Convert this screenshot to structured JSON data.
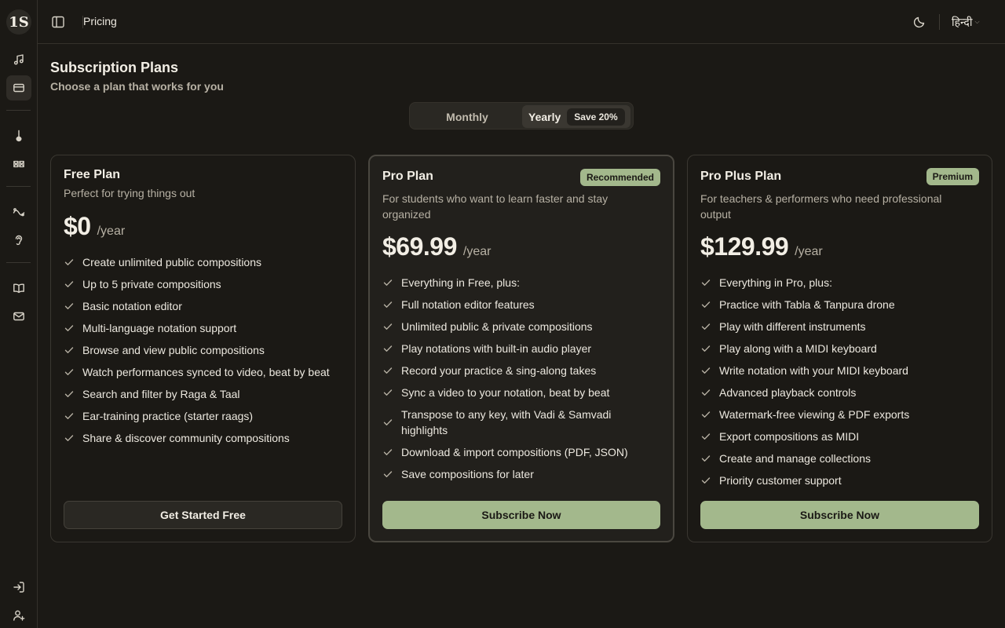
{
  "app": {
    "logo_text": "1S",
    "breadcrumb": "Pricing",
    "language": "हिन्दी"
  },
  "sidebar": {
    "items": [
      {
        "icon": "music-note-icon"
      },
      {
        "icon": "credit-card-icon",
        "active": true
      },
      {
        "icon": "tanpura-icon"
      },
      {
        "icon": "tabla-icon"
      },
      {
        "icon": "waveform-icon"
      },
      {
        "icon": "ear-icon"
      },
      {
        "icon": "book-icon"
      },
      {
        "icon": "mail-icon"
      },
      {
        "icon": "login-icon"
      },
      {
        "icon": "add-user-icon"
      }
    ]
  },
  "page": {
    "title": "Subscription Plans",
    "subtitle": "Choose a plan that works for you"
  },
  "billing": {
    "monthly_label": "Monthly",
    "yearly_label": "Yearly",
    "save_badge": "Save 20%",
    "selected": "Yearly"
  },
  "plans": {
    "free": {
      "name": "Free Plan",
      "desc": "Perfect for trying things out",
      "price": "$0",
      "period": "/year",
      "features": [
        "Create unlimited public compositions",
        "Up to 5 private compositions",
        "Basic notation editor",
        "Multi-language notation support",
        "Browse and view public compositions",
        "Watch performances synced to video, beat by beat",
        "Search and filter by Raga & Taal",
        "Ear-training practice (starter raags)",
        "Share & discover community compositions"
      ],
      "cta": "Get Started Free"
    },
    "pro": {
      "name": "Pro Plan",
      "badge": "Recommended",
      "desc": "For students who want to learn faster and stay organized",
      "price": "$69.99",
      "period": "/year",
      "features": [
        "Everything in Free, plus:",
        "Full notation editor features",
        "Unlimited public & private compositions",
        "Play notations with built-in audio player",
        "Record your practice & sing-along takes",
        "Sync a video to your notation, beat by beat",
        "Transpose to any key, with Vadi & Samvadi highlights",
        "Download & import compositions (PDF, JSON)",
        "Save compositions for later"
      ],
      "cta": "Subscribe Now"
    },
    "proplus": {
      "name": "Pro Plus Plan",
      "badge": "Premium",
      "desc": "For teachers & performers who need professional output",
      "price": "$129.99",
      "period": "/year",
      "features": [
        "Everything in Pro, plus:",
        "Practice with Tabla & Tanpura drone",
        "Play with different instruments",
        "Play along with a MIDI keyboard",
        "Write notation with your MIDI keyboard",
        "Advanced playback controls",
        "Watermark-free viewing & PDF exports",
        "Export compositions as MIDI",
        "Create and manage collections",
        "Priority customer support"
      ],
      "cta": "Subscribe Now"
    }
  },
  "colors": {
    "background": "#1b1915",
    "accent": "#a3b88c",
    "text": "#ece8df",
    "muted": "#b7b1a4"
  }
}
